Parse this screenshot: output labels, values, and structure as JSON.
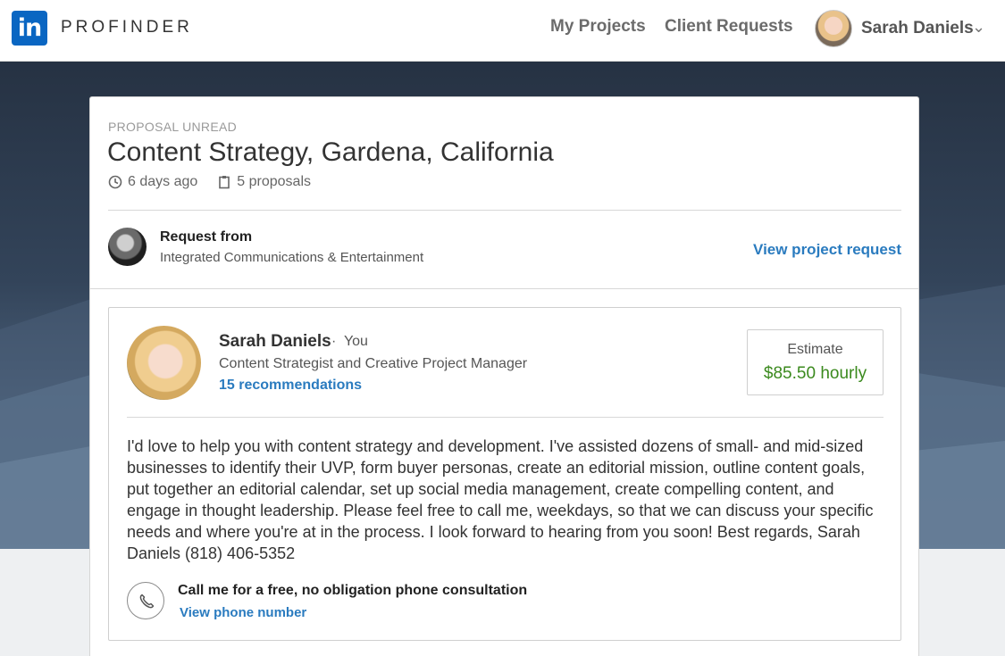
{
  "header": {
    "logo_text": "in",
    "brand": "PROFINDER",
    "nav": {
      "my_projects": "My Projects",
      "client_requests": "Client Requests"
    },
    "user": {
      "name": "Sarah Daniels",
      "avatar_icon": "user-avatar",
      "menu_icon": "chevron-down-icon"
    }
  },
  "project": {
    "status": "PROPOSAL UNREAD",
    "title": "Content Strategy, Gardena, California",
    "posted": "6 days ago",
    "proposals": "5 proposals",
    "posted_icon": "clock-icon",
    "proposals_icon": "clipboard-icon"
  },
  "request": {
    "label": "Request from",
    "client": "Integrated Communications & Entertainment",
    "view_link": "View project request"
  },
  "proposal": {
    "name": "Sarah Daniels",
    "separator": "·",
    "you": "You",
    "headline": "Content Strategist and Creative Project Manager",
    "recommendations": "15 recommendations",
    "estimate": {
      "label": "Estimate",
      "value": "$85.50 hourly"
    },
    "message": "I'd love to help you with content strategy and development.  I've assisted dozens of small- and mid-sized businesses to identify their UVP, form buyer personas, create an editorial mission, outline content goals, put together an editorial calendar, set up social media management, create compelling content, and engage in thought leadership.  Please feel free to call me, weekdays, so that we can discuss your specific needs and where you're at in the process.  I look forward to hearing from you soon!  Best regards, Sarah Daniels (818) 406-5352",
    "call": {
      "title": "Call me for a free, no obligation phone consultation",
      "link": "View phone number",
      "icon": "phone-icon"
    }
  },
  "colors": {
    "brand_blue": "#0a66c2",
    "link_blue": "#2a7bbf",
    "estimate_green": "#3b8a1e"
  }
}
